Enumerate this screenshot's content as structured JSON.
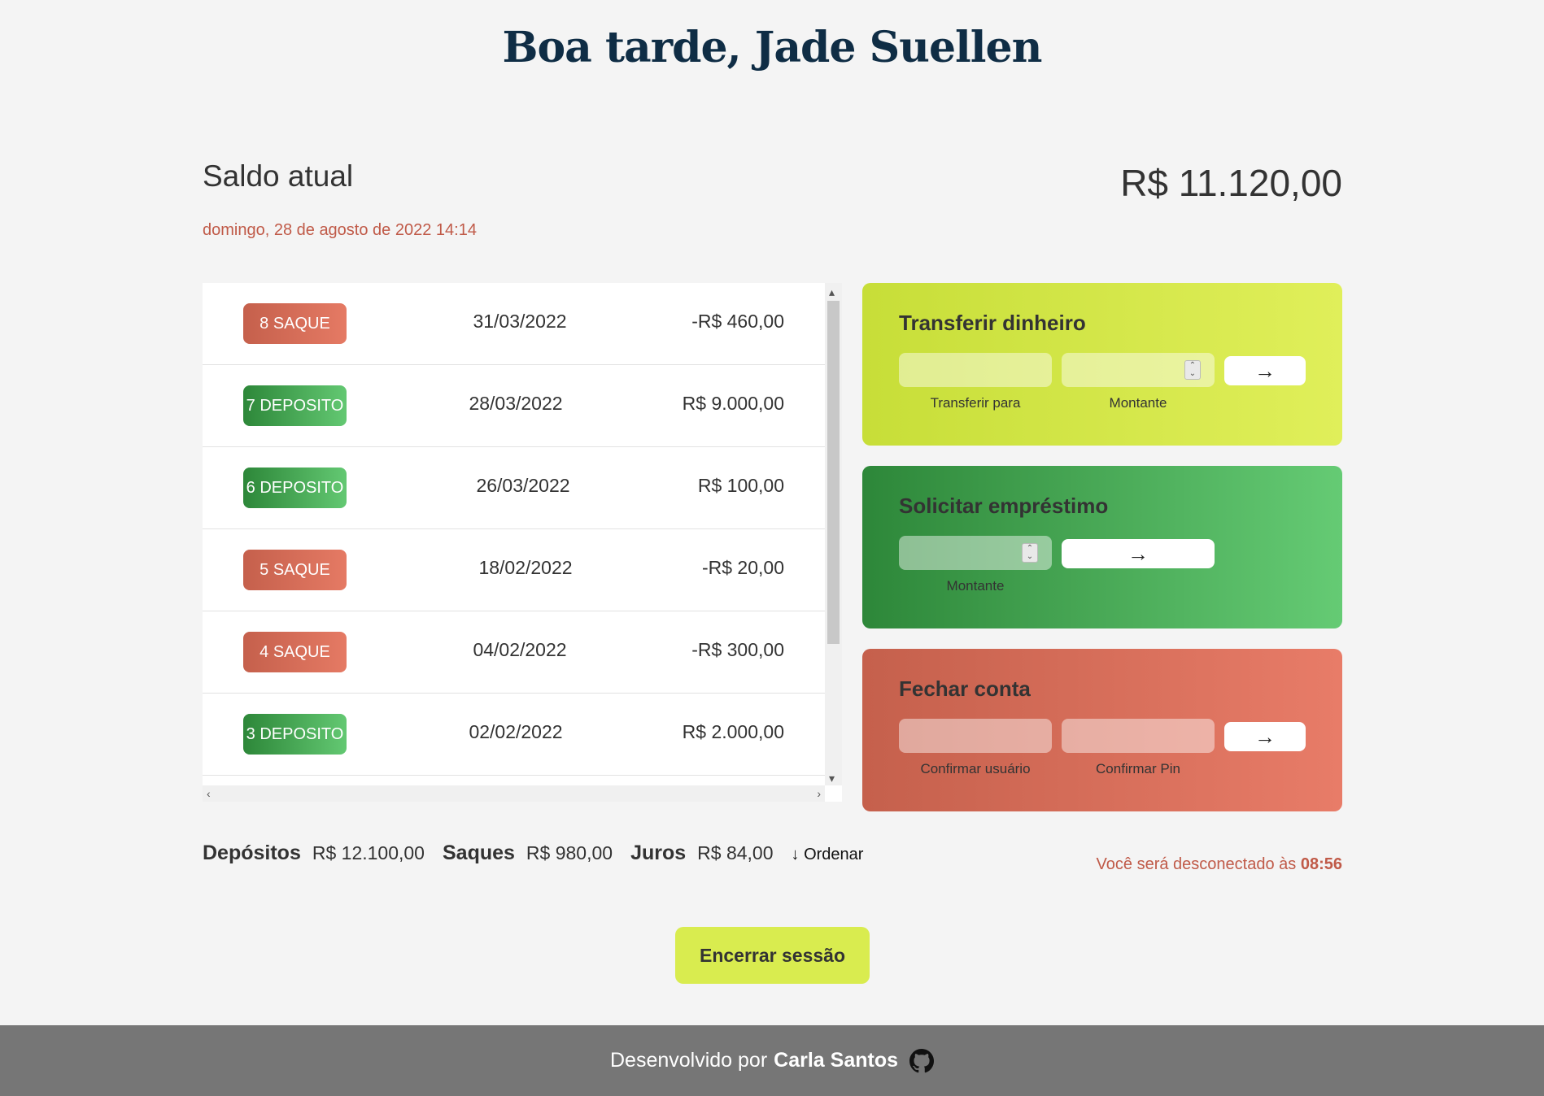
{
  "greeting": "Boa tarde, Jade Suellen",
  "balance": {
    "label": "Saldo atual",
    "date": "domingo, 28 de agosto de 2022 14:14",
    "value": "R$ 11.120,00"
  },
  "movements": [
    {
      "badge": "8 SAQUE",
      "type": "saque",
      "date": "31/03/2022",
      "value": "-R$ 460,00"
    },
    {
      "badge": "7 DEPOSITO",
      "type": "deposito",
      "date": "28/03/2022",
      "value": "R$ 9.000,00"
    },
    {
      "badge": "6 DEPOSITO",
      "type": "deposito",
      "date": "26/03/2022",
      "value": "R$ 100,00"
    },
    {
      "badge": "5 SAQUE",
      "type": "saque",
      "date": "18/02/2022",
      "value": "-R$ 20,00"
    },
    {
      "badge": "4 SAQUE",
      "type": "saque",
      "date": "04/02/2022",
      "value": "-R$ 300,00"
    },
    {
      "badge": "3 DEPOSITO",
      "type": "deposito",
      "date": "02/02/2022",
      "value": "R$ 2.000,00"
    }
  ],
  "operations": {
    "transfer": {
      "title": "Transferir dinheiro",
      "label_to": "Transferir para",
      "label_amount": "Montante",
      "button": "→"
    },
    "loan": {
      "title": "Solicitar empréstimo",
      "label_amount": "Montante",
      "button": "→"
    },
    "close": {
      "title": "Fechar conta",
      "label_user": "Confirmar usuário",
      "label_pin": "Confirmar Pin",
      "button": "→"
    }
  },
  "summary": {
    "deposits_label": "Depósitos",
    "deposits_value": "R$ 12.100,00",
    "withdrawals_label": "Saques",
    "withdrawals_value": "R$ 980,00",
    "interest_label": "Juros",
    "interest_value": "R$ 84,00",
    "sort_label": "↓ Ordenar"
  },
  "logout": {
    "text": "Você será desconectado às",
    "time": "08:56"
  },
  "end_session": "Encerrar sessão",
  "footer": {
    "prefix": "Desenvolvido por",
    "author": "Carla Santos",
    "icon": "github-icon"
  },
  "colors": {
    "saque": "#c5604c",
    "deposito": "#2d8739",
    "transfer": "#d3e84a",
    "accent_text": "#c05a48",
    "title": "#0f2d45"
  }
}
